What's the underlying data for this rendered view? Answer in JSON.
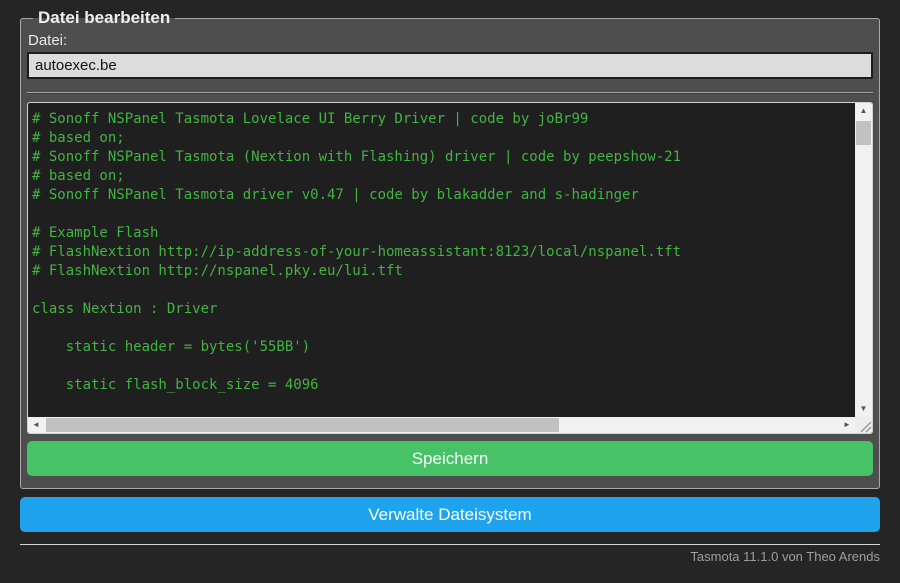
{
  "editor": {
    "legend": "Datei bearbeiten",
    "file_label": "Datei:",
    "filename": "autoexec.be",
    "save_label": "Speichern",
    "code_lines": [
      "# Sonoff NSPanel Tasmota Lovelace UI Berry Driver | code by joBr99",
      "# based on;",
      "# Sonoff NSPanel Tasmota (Nextion with Flashing) driver | code by peepshow-21",
      "# based on;",
      "# Sonoff NSPanel Tasmota driver v0.47 | code by blakadder and s-hadinger",
      "",
      "# Example Flash",
      "# FlashNextion http://ip-address-of-your-homeassistant:8123/local/nspanel.tft",
      "# FlashNextion http://nspanel.pky.eu/lui.tft",
      "",
      "class Nextion : Driver",
      "",
      "    static header = bytes('55BB')",
      "",
      "    static flash_block_size = 4096"
    ]
  },
  "actions": {
    "manage_fs_label": "Verwalte Dateisystem"
  },
  "footer": {
    "version_text": "Tasmota 11.1.0 von Theo Arends"
  },
  "icons": {
    "up_arrow": "▲",
    "down_arrow": "▼",
    "left_arrow": "◄",
    "right_arrow": "►"
  },
  "colors": {
    "page_background": "#252525",
    "panel_background": "#4e4e4e",
    "console_background": "#1f1f1f",
    "console_text": "#41b441",
    "save_button": "#47c266",
    "manage_button": "#1fa3ec",
    "button_text": "#faffff",
    "input_background": "#dcdcdc"
  }
}
